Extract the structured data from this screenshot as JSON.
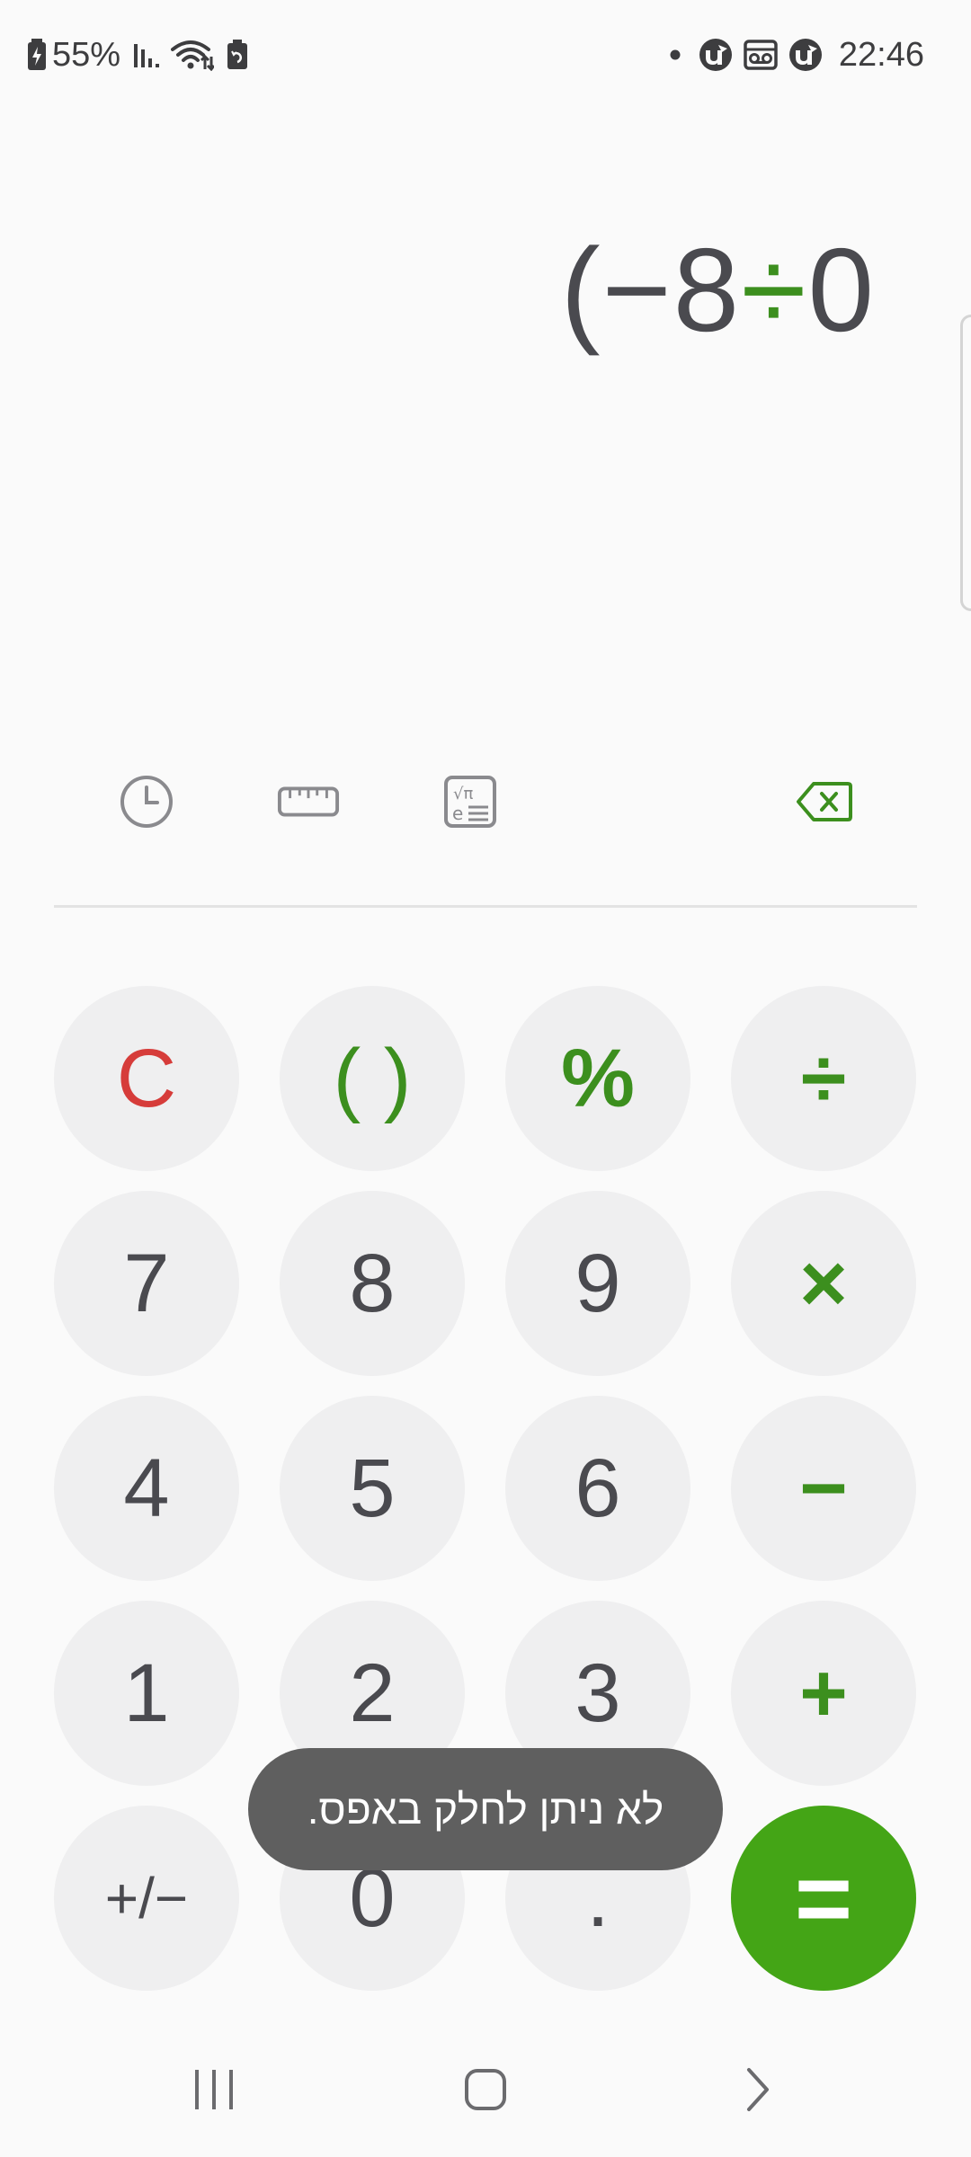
{
  "status_bar": {
    "battery": "55%",
    "time": "22:46",
    "icons_left": [
      "battery-saver-icon",
      "signal-icon",
      "wifi-icon",
      "clean-battery-icon"
    ],
    "icons_right": [
      "notification-dot-icon",
      "utorrent-icon",
      "voicemail-icon",
      "utorrent-icon"
    ]
  },
  "display": {
    "expression_parts": [
      "(−8",
      "÷",
      "0"
    ]
  },
  "toolbar": {
    "icons": [
      "history-icon",
      "unit-converter-icon",
      "scientific-icon",
      "backspace-icon"
    ]
  },
  "keypad": {
    "rows": [
      [
        {
          "label": "C",
          "style": "red"
        },
        {
          "label": "( )",
          "style": "green"
        },
        {
          "label": "%",
          "style": "green"
        },
        {
          "label": "÷",
          "style": "green"
        }
      ],
      [
        {
          "label": "7"
        },
        {
          "label": "8"
        },
        {
          "label": "9"
        },
        {
          "label": "×",
          "style": "green"
        }
      ],
      [
        {
          "label": "4"
        },
        {
          "label": "5"
        },
        {
          "label": "6"
        },
        {
          "label": "−",
          "style": "green"
        }
      ],
      [
        {
          "label": "1"
        },
        {
          "label": "2"
        },
        {
          "label": "3"
        },
        {
          "label": "+",
          "style": "green"
        }
      ],
      [
        {
          "label": "+/−"
        },
        {
          "label": "0"
        },
        {
          "label": "."
        },
        {
          "label": "=",
          "style": "equals"
        }
      ]
    ]
  },
  "toast": {
    "message": "לא ניתן לחלק באפס."
  },
  "nav_bar": {
    "buttons": [
      "recent-apps-icon",
      "home-icon",
      "back-icon"
    ]
  },
  "colors": {
    "accent_green": "#3c8f1e",
    "equals_green": "#44a516",
    "clear_red": "#d63c3a",
    "key_bg": "#efeff0",
    "toast_bg": "#5f5f5f"
  }
}
